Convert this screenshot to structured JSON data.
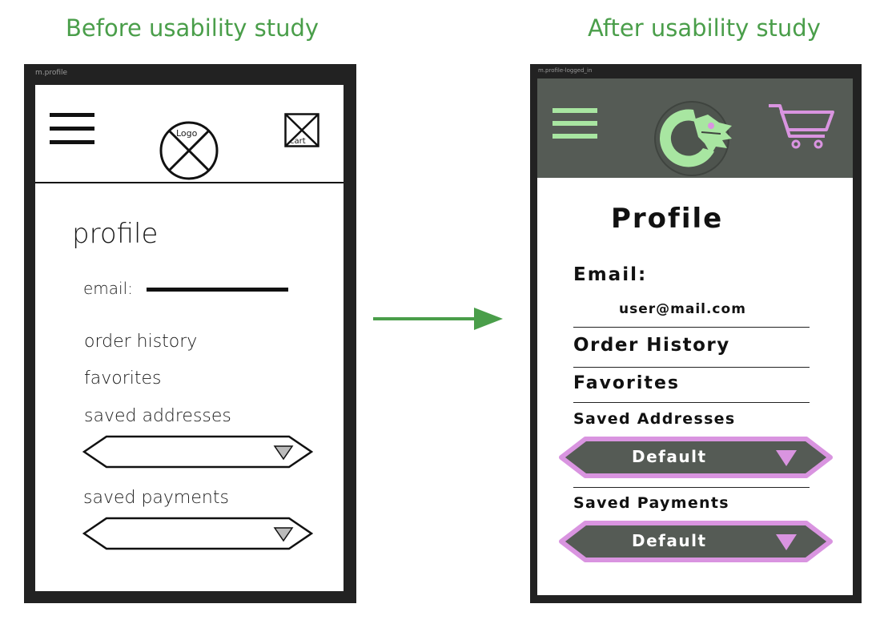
{
  "headings": {
    "before": "Before usability study",
    "after": "After usability study"
  },
  "colors": {
    "heading": "#4a9e4a",
    "arrow": "#4a9e4a",
    "hifi_header_bg": "#555b55",
    "hifi_accent_green": "#a8e6a1",
    "hifi_accent_pink": "#d994e0",
    "dropdown_bg": "#555b55"
  },
  "before": {
    "frame_label": "m.profile",
    "logo_text": "Logo",
    "cart_text": "cart",
    "title": "profile",
    "email_label": "email:",
    "order_history": "order history",
    "favorites": "favorites",
    "saved_addresses": "saved addresses",
    "saved_payments": "saved payments"
  },
  "after": {
    "frame_label": "m.profile-logged_in",
    "title": "Profile",
    "email_label": "Email:",
    "email_value": "user@mail.com",
    "order_history": "Order History",
    "favorites": "Favorites",
    "saved_addresses": "Saved Addresses",
    "address_dropdown_value": "Default",
    "saved_payments": "Saved Payments",
    "payment_dropdown_value": "Default"
  },
  "icons": {
    "menu": "hamburger-menu-icon",
    "logo": "logo-placeholder-icon",
    "cart": "cart-icon",
    "arrow": "right-arrow-icon",
    "caret": "triangle-down-icon"
  }
}
